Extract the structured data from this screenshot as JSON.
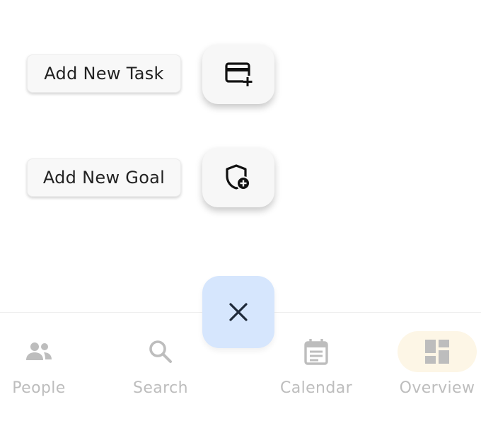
{
  "speed_dial": {
    "actions": [
      {
        "label": "Add New Task",
        "icon": "card-plus-icon"
      },
      {
        "label": "Add New Goal",
        "icon": "shield-plus-icon"
      }
    ],
    "close_icon": "close-icon",
    "fab_color": "#d6e6fd"
  },
  "bottom_nav": {
    "items": [
      {
        "label": "People",
        "icon": "people-icon"
      },
      {
        "label": "Search",
        "icon": "search-icon"
      },
      {
        "label": "Calendar",
        "icon": "calendar-icon"
      },
      {
        "label": "Overview",
        "icon": "dashboard-icon",
        "active": true
      }
    ],
    "active_indicator_color": "#fdf6e6",
    "inactive_color": "#bdbdbd"
  }
}
